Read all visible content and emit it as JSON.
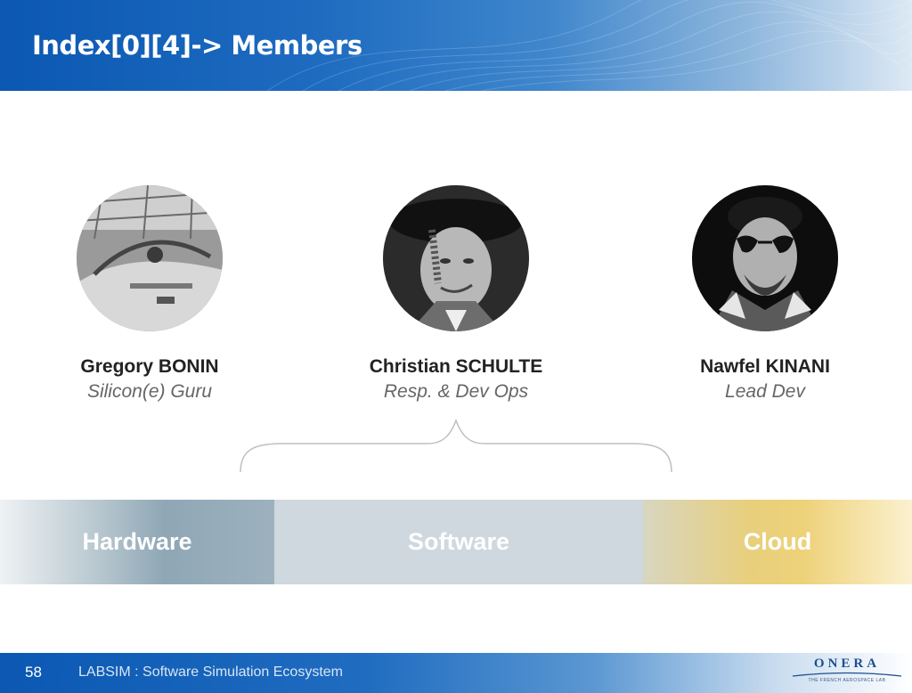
{
  "slide": {
    "title": "Index[0][4]-> Members",
    "page_number": "58",
    "footer_text": "LABSIM : Software Simulation Ecosystem"
  },
  "members": [
    {
      "name": "Gregory BONIN",
      "role": "Silicon(e) Guru",
      "photo": "photo-gregory-bonin"
    },
    {
      "name": "Christian SCHULTE",
      "role": "Resp. & Dev Ops",
      "photo": "photo-christian-schulte"
    },
    {
      "name": "Nawfel KINANI",
      "role": "Lead Dev",
      "photo": "photo-nawfel-kinani"
    }
  ],
  "domains": [
    {
      "label": "Hardware"
    },
    {
      "label": "Software"
    },
    {
      "label": "Cloud"
    }
  ],
  "logo": {
    "wordmark": "ONERA",
    "tagline": "THE FRENCH AEROSPACE LAB"
  },
  "colors": {
    "header_blue": "#0b58b3",
    "name_text": "#222222",
    "role_text": "#666666",
    "cloud_gold": "#eed27a"
  }
}
